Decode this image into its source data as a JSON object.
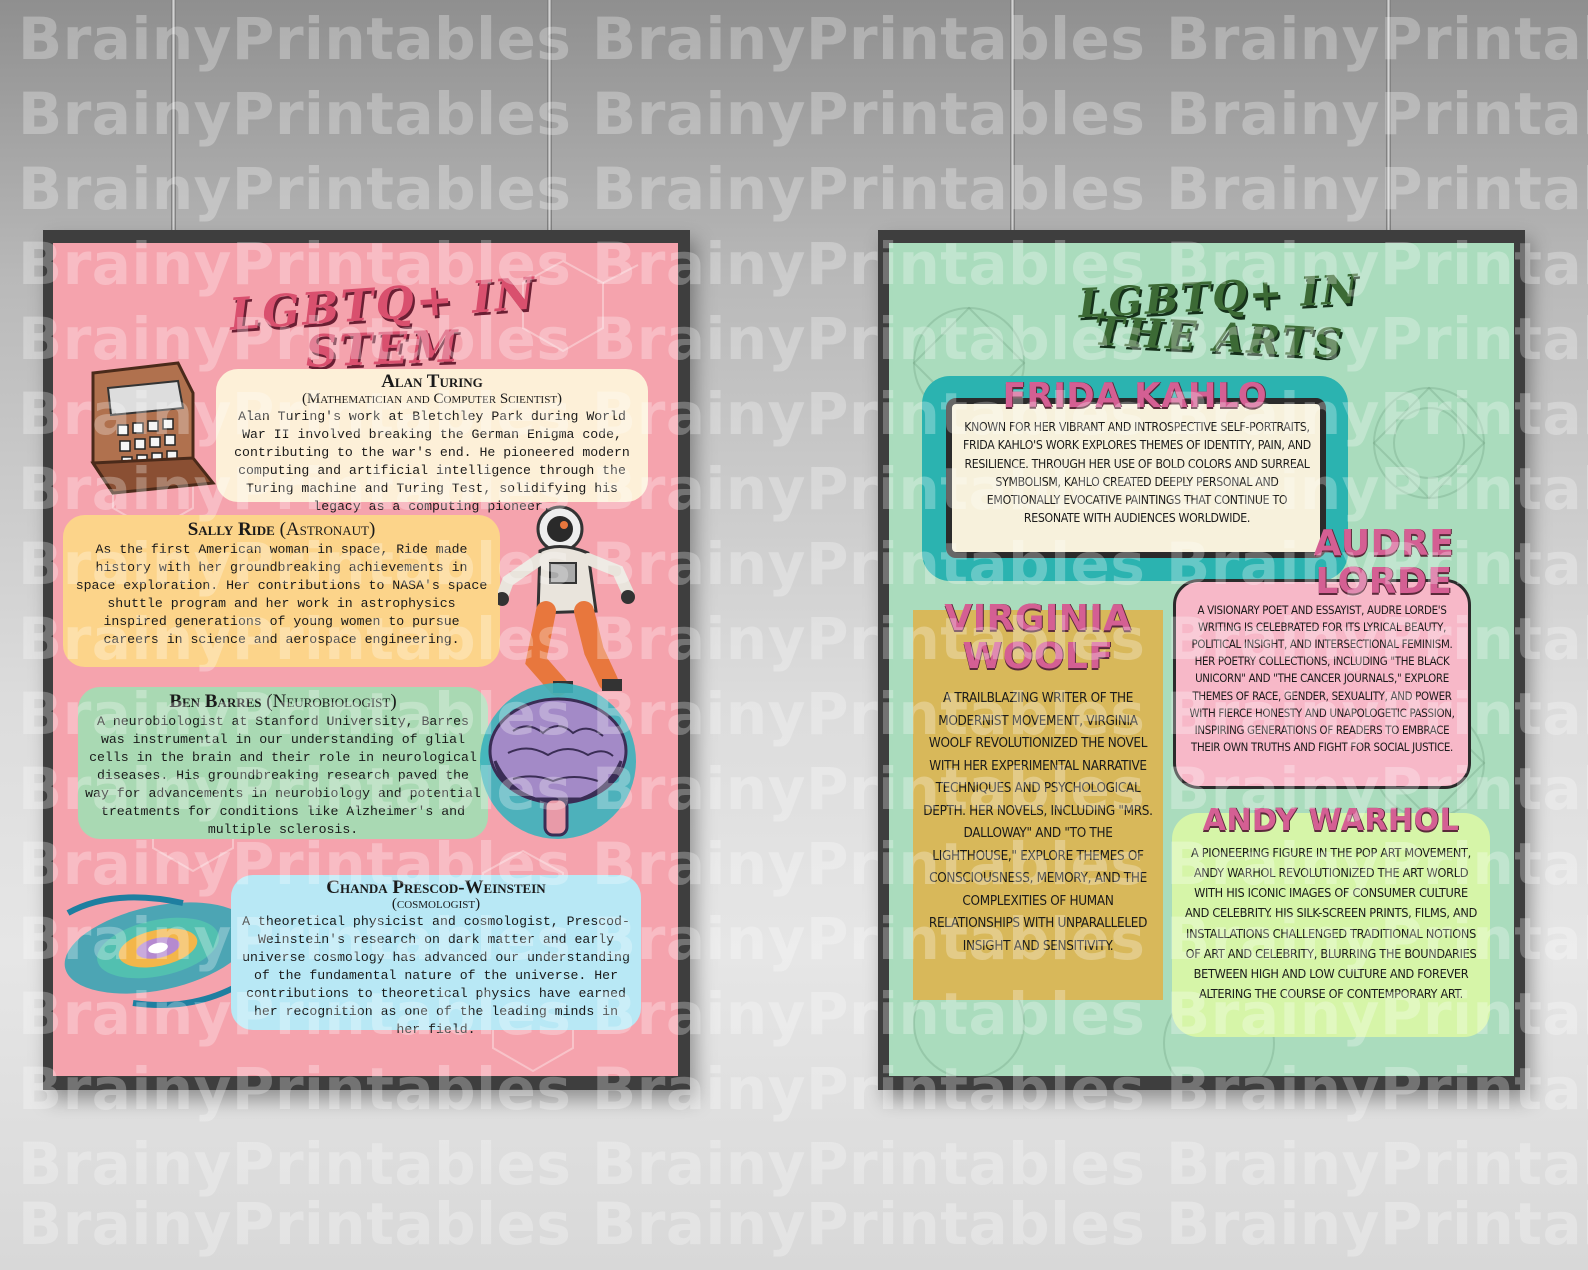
{
  "watermark": "BrainyPrintables BrainyPrintables BrainyPrintables",
  "stem": {
    "title_line1": "LGBTQ+ IN",
    "title_line2": "STEM",
    "people": [
      {
        "name": "Alan Turing",
        "role": "(Mathematician and Computer Scientist)",
        "bio": "Alan Turing's work at Bletchley Park during World War II involved breaking the German Enigma code, contributing to the war's end. He pioneered modern computing and artificial intelligence through the Turing machine and Turing Test, solidifying his legacy as a computing pioneer."
      },
      {
        "name": "Sally Ride",
        "role": "(Astronaut)",
        "bio": "As the first American woman in space, Ride made history with her groundbreaking achievements in space exploration. Her contributions to NASA's space shuttle program and her work in astrophysics inspired generations of young women to pursue careers in science and aerospace engineering."
      },
      {
        "name": "Ben Barres",
        "role": "(Neurobiologist)",
        "bio": "A neurobiologist at Stanford University, Barres was instrumental in our understanding of glial cells in the brain and their role in neurological diseases. His groundbreaking research paved the way for advancements in neurobiology and potential treatments for conditions like Alzheimer's and multiple sclerosis."
      },
      {
        "name": "Chanda Prescod-Weinstein",
        "role": "(cosmologist)",
        "bio": "A theoretical physicist and cosmologist, Prescod-Weinstein's research on dark matter and early universe cosmology has advanced our understanding of the fundamental nature of the universe. Her contributions to theoretical physics have earned her recognition as one of the leading minds in her field."
      }
    ]
  },
  "arts": {
    "title_line1": "LGBTQ+ IN",
    "title_line2": "THE ARTS",
    "people": [
      {
        "name": "FRIDA KAHLO",
        "bio": "Known for her vibrant and introspective self-portraits, Frida Kahlo's work explores themes of identity, pain, and resilience. Through her use of bold colors and surreal symbolism, Kahlo created deeply personal and emotionally evocative paintings that continue to resonate with audiences worldwide."
      },
      {
        "name_line1": "AUDRE",
        "name_line2": "LORDE",
        "bio": "A visionary poet and essayist, Audre Lorde's writing is celebrated for its lyrical beauty, political insight, and intersectional feminism. Her poetry collections, including \"The Black Unicorn\" and \"The Cancer Journals,\" explore themes of race, gender, sexuality, and power with fierce honesty and unapologetic passion, inspiring generations of readers to embrace their own truths and fight for social justice."
      },
      {
        "name_line1": "VIRGINIA",
        "name_line2": "WOOLF",
        "bio": "A trailblazing writer of the modernist movement, Virginia Woolf revolutionized the novel with her experimental narrative techniques and psychological depth. Her novels, including \"Mrs. Dalloway\" and \"To the Lighthouse,\" explore themes of consciousness, memory, and the complexities of human relationships with unparalleled insight and sensitivity."
      },
      {
        "name": "ANDY WARHOL",
        "bio": "A pioneering figure in the pop art movement, Andy Warhol revolutionized the art world with his iconic images of consumer culture and celebrity. His silk-screen prints, films, and installations challenged traditional notions of art and celebrity, blurring the boundaries between high and low culture and forever altering the course of contemporary art."
      }
    ]
  },
  "colors": {
    "stem_bg": "#f5a3ad",
    "arts_bg": "#aadcbd",
    "turing_card": "#fdf0d8",
    "ride_card": "#fcd48a",
    "barres_card": "#a9d9b3",
    "chanda_card": "#b8e8f5",
    "frida_frame": "#2bb3b0",
    "lorde_card": "#f7b8c8",
    "woolf_card": "#d8b85a",
    "warhol_card": "#d6f5a8"
  }
}
